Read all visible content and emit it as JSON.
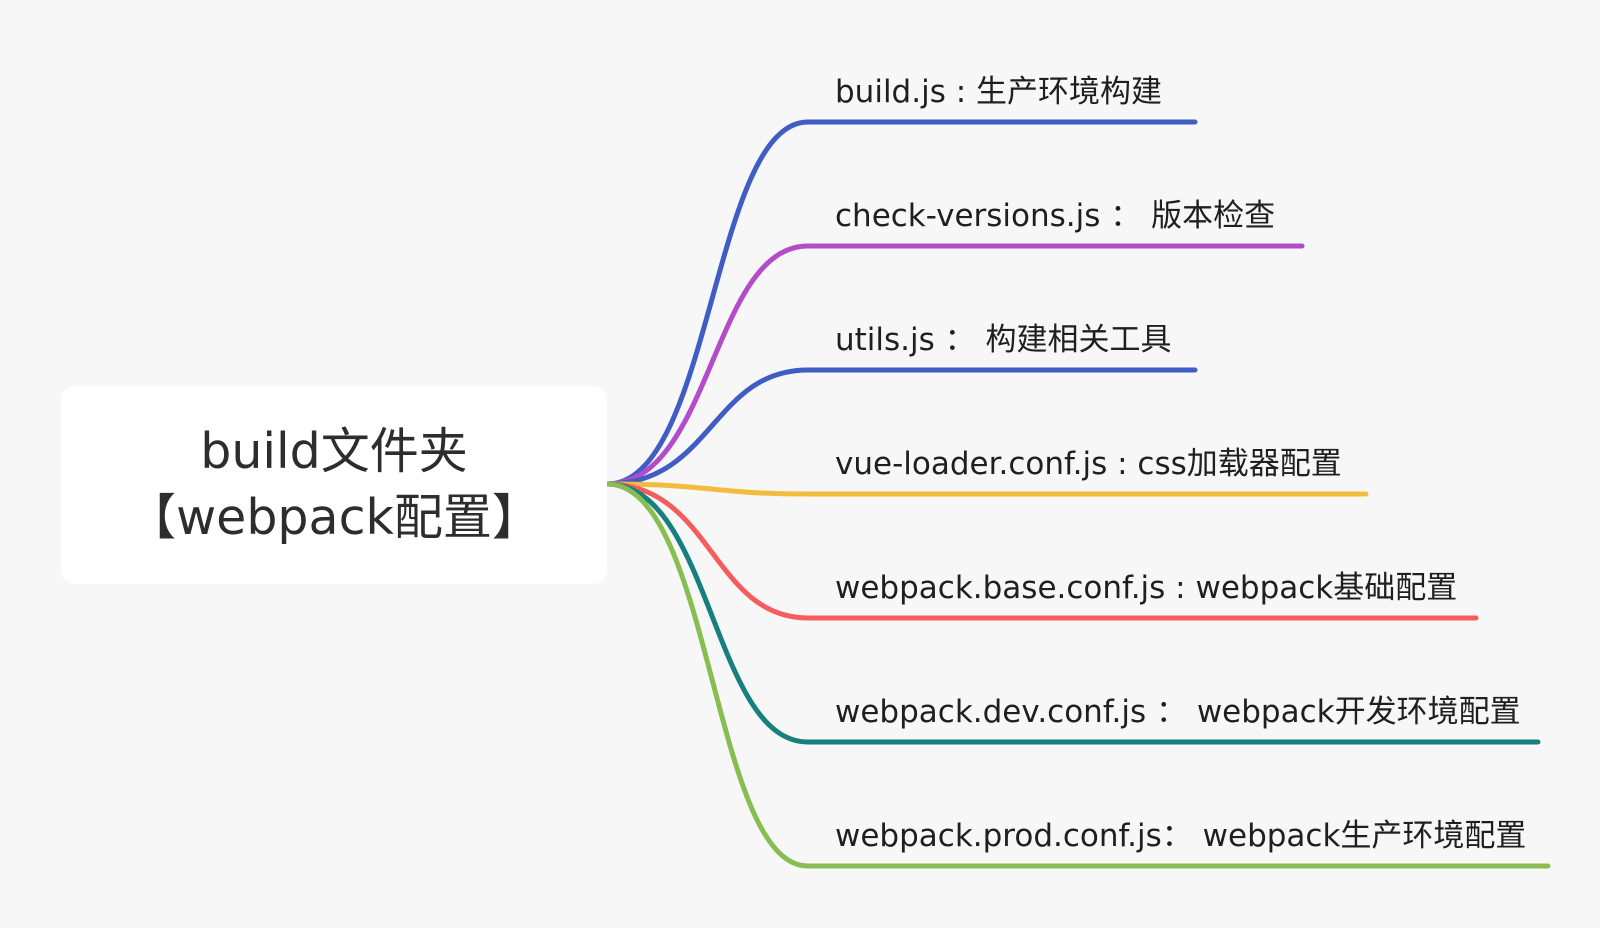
{
  "mindmap": {
    "root": {
      "line1": "build文件夹",
      "line2": "【webpack配置】"
    },
    "branches": [
      {
        "text": "build.js : 生产环境构建",
        "color": "#3f5dc4"
      },
      {
        "text": "check-versions.js ：  版本检查",
        "color": "#b34cc8"
      },
      {
        "text": "utils.js ： 构建相关工具",
        "color": "#3f5dc4"
      },
      {
        "text": "vue-loader.conf.js : css加载器配置",
        "color": "#f4bc3c"
      },
      {
        "text": "webpack.base.conf.js : webpack基础配置",
        "color": "#f45c5e"
      },
      {
        "text": "webpack.dev.conf.js ：  webpack开发环境配置",
        "color": "#177f7d"
      },
      {
        "text": "webpack.prod.conf.js：  webpack生产环境配置",
        "color": "#88bd52"
      }
    ]
  }
}
